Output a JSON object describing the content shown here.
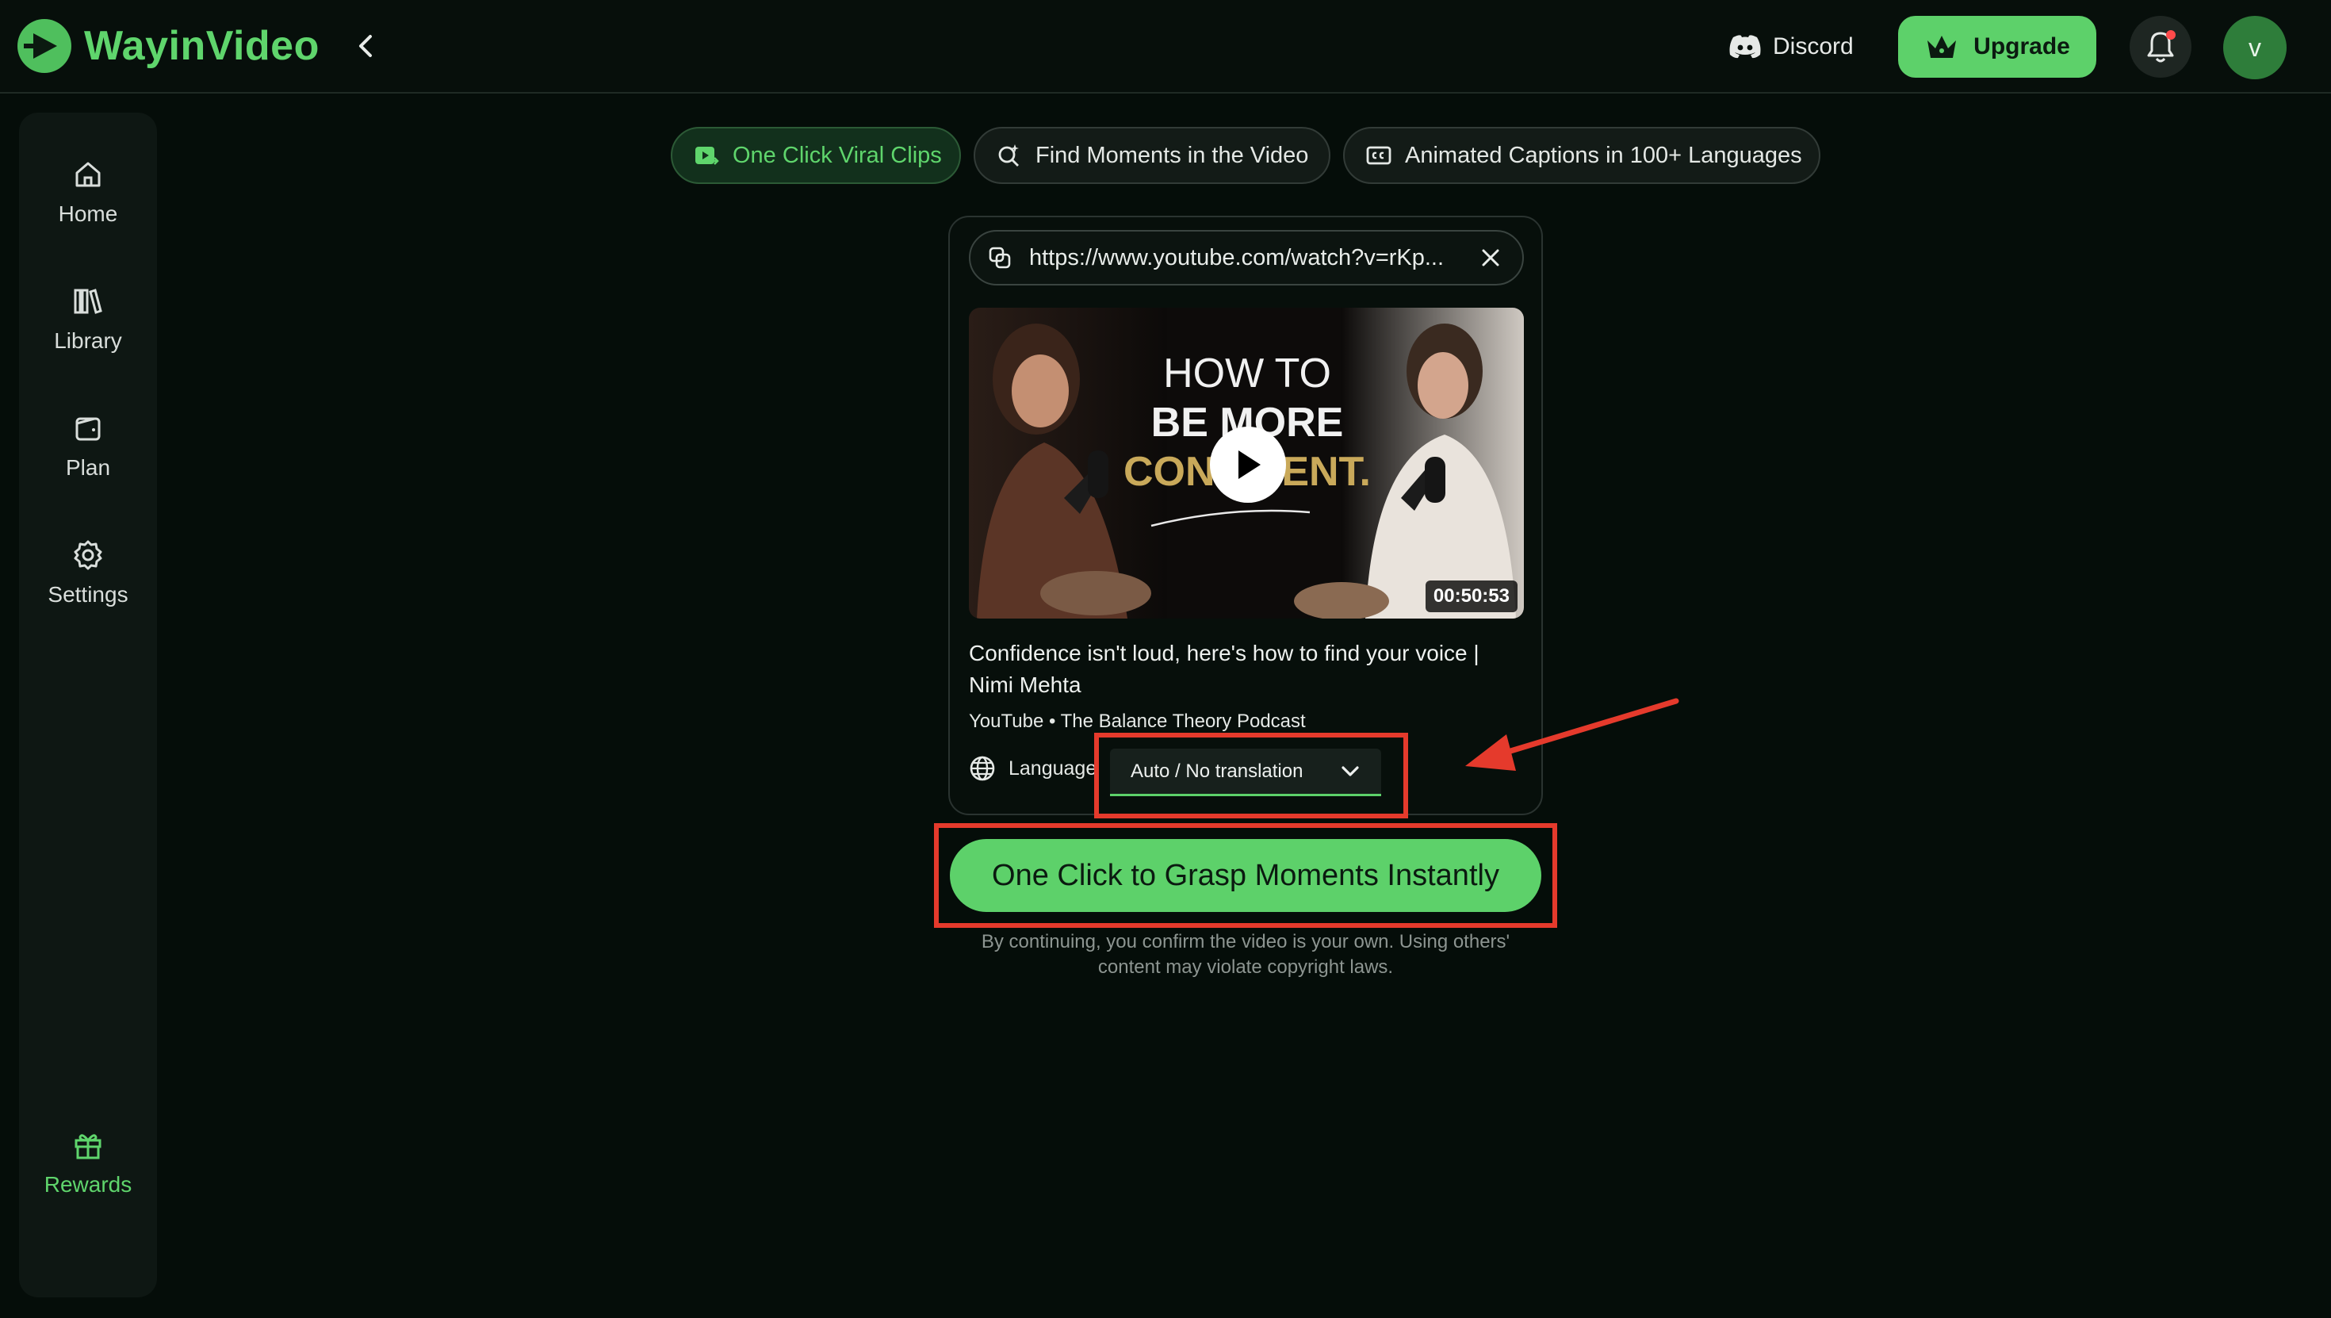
{
  "app": {
    "name": "WayinVideo",
    "accent_color": "#5fd56c"
  },
  "header": {
    "discord_label": "Discord",
    "upgrade_label": "Upgrade",
    "avatar_initial": "v",
    "icons": [
      "logo-icon",
      "chevron-left-icon",
      "discord-icon",
      "crown-icon",
      "bell-icon"
    ]
  },
  "sidebar": {
    "items": [
      {
        "label": "Home",
        "icon": "home-icon"
      },
      {
        "label": "Library",
        "icon": "library-icon"
      },
      {
        "label": "Plan",
        "icon": "wallet-icon"
      },
      {
        "label": "Settings",
        "icon": "gear-icon"
      }
    ],
    "rewards": {
      "label": "Rewards",
      "icon": "gift-icon"
    }
  },
  "tabs": [
    {
      "label": "One Click Viral Clips",
      "active": true,
      "icon": "clip-icon"
    },
    {
      "label": "Find Moments in the Video",
      "active": false,
      "icon": "search-sparkle-icon"
    },
    {
      "label": "Animated Captions in 100+ Languages",
      "active": false,
      "icon": "captions-icon"
    }
  ],
  "card": {
    "url_value": "https://www.youtube.com/watch?v=rKp...",
    "thumbnail": {
      "title_line1": "HOW TO",
      "title_line2": "BE MORE",
      "title_line3": "CONFIDENT.",
      "duration": "00:50:53"
    },
    "video_title": "Confidence isn't loud, here's how to find your voice | Nimi Mehta",
    "video_meta": "YouTube • The Balance Theory Podcast",
    "language_label": "Language",
    "language_value": "Auto / No translation"
  },
  "cta_label": "One Click to Grasp Moments Instantly",
  "disclaimer": "By continuing, you confirm the video is your own. Using others' content may violate copyright laws."
}
